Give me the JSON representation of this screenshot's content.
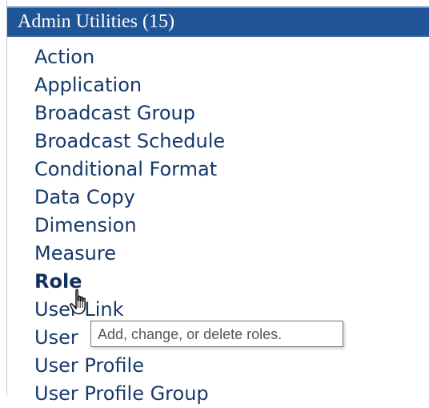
{
  "header": {
    "title": "Admin Utilities (15)"
  },
  "menu": {
    "items": [
      {
        "label": "Action"
      },
      {
        "label": "Application"
      },
      {
        "label": "Broadcast Group"
      },
      {
        "label": "Broadcast Schedule"
      },
      {
        "label": "Conditional Format"
      },
      {
        "label": "Data Copy"
      },
      {
        "label": "Dimension"
      },
      {
        "label": "Measure"
      },
      {
        "label": "Role",
        "state": "hovered"
      },
      {
        "label": "User Link"
      },
      {
        "label": "User"
      },
      {
        "label": "User Profile"
      },
      {
        "label": "User Profile Group"
      }
    ]
  },
  "tooltip": {
    "text": "Add, change, or delete roles."
  },
  "cursor": {
    "icon": "hand-pointer-icon"
  },
  "colors": {
    "header_bg": "#1f5597",
    "menu_text": "#14396a",
    "tooltip_text": "#575757"
  }
}
